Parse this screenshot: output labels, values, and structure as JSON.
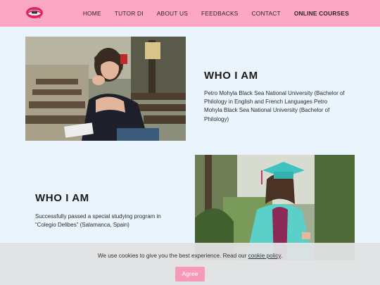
{
  "header": {
    "logo": "lips-logo-icon",
    "nav": [
      {
        "label": "HOME"
      },
      {
        "label": "TUTOR DI"
      },
      {
        "label": "ABOUT US"
      },
      {
        "label": "FEEDBACKS"
      },
      {
        "label": "CONTACT"
      },
      {
        "label": "ONLINE COURSES"
      }
    ]
  },
  "section1": {
    "heading": "WHO I AM",
    "text": "Petro Mohyla Black Sea National University (Bachelor of Philology in English and French Languages Petro Mohyla Black Sea National University (Bachelor of Philology)"
  },
  "section2": {
    "heading": "WHO I AM",
    "text": "Successfully passed a special studying program in “Colegio Delibes” (Salamanca, Spain)"
  },
  "cookie": {
    "text": "We use cookies to give you the best experience. Read our",
    "link": "cookie policy",
    "period": ".",
    "button": "Agree"
  },
  "colors": {
    "header": "#fba7c3",
    "background": "#eaf4fc",
    "accent": "#f79ab9"
  }
}
